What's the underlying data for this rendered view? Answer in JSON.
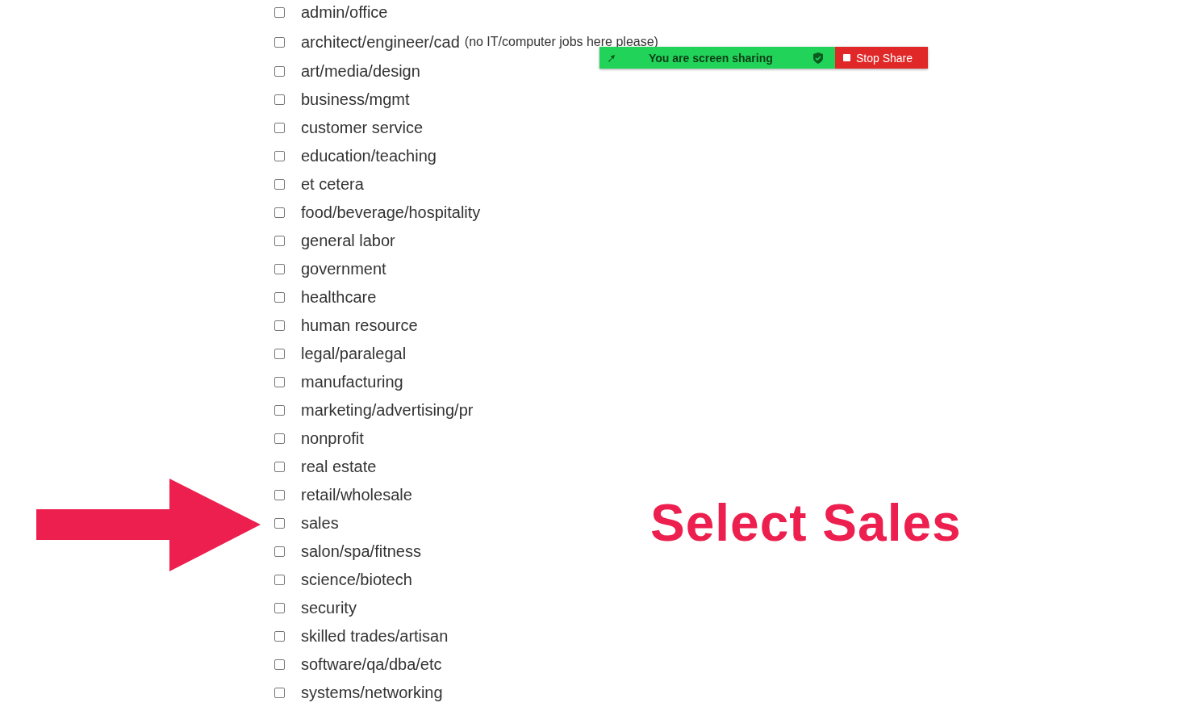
{
  "categories": [
    {
      "label": "admin/office",
      "checked": false
    },
    {
      "label": "architect/engineer/cad",
      "note": "(no IT/computer jobs here please)",
      "checked": false
    },
    {
      "label": "art/media/design",
      "checked": false
    },
    {
      "label": "business/mgmt",
      "checked": false
    },
    {
      "label": "customer service",
      "checked": false
    },
    {
      "label": "education/teaching",
      "checked": false
    },
    {
      "label": "et cetera",
      "checked": false
    },
    {
      "label": "food/beverage/hospitality",
      "checked": false
    },
    {
      "label": "general labor",
      "checked": false
    },
    {
      "label": "government",
      "checked": false
    },
    {
      "label": "healthcare",
      "checked": false
    },
    {
      "label": "human resource",
      "checked": false
    },
    {
      "label": "legal/paralegal",
      "checked": false
    },
    {
      "label": "manufacturing",
      "checked": false
    },
    {
      "label": "marketing/advertising/pr",
      "checked": false
    },
    {
      "label": "nonprofit",
      "checked": false
    },
    {
      "label": "real estate",
      "checked": false
    },
    {
      "label": "retail/wholesale",
      "checked": false
    },
    {
      "label": "sales",
      "checked": false
    },
    {
      "label": "salon/spa/fitness",
      "checked": false
    },
    {
      "label": "science/biotech",
      "checked": false
    },
    {
      "label": "security",
      "checked": false
    },
    {
      "label": "skilled trades/artisan",
      "checked": false
    },
    {
      "label": "software/qa/dba/etc",
      "checked": false
    },
    {
      "label": "systems/networking",
      "checked": false
    }
  ],
  "share_bar": {
    "status": "You are screen sharing",
    "stop_button": "Stop Share"
  },
  "annotation": {
    "text": "Select Sales"
  }
}
